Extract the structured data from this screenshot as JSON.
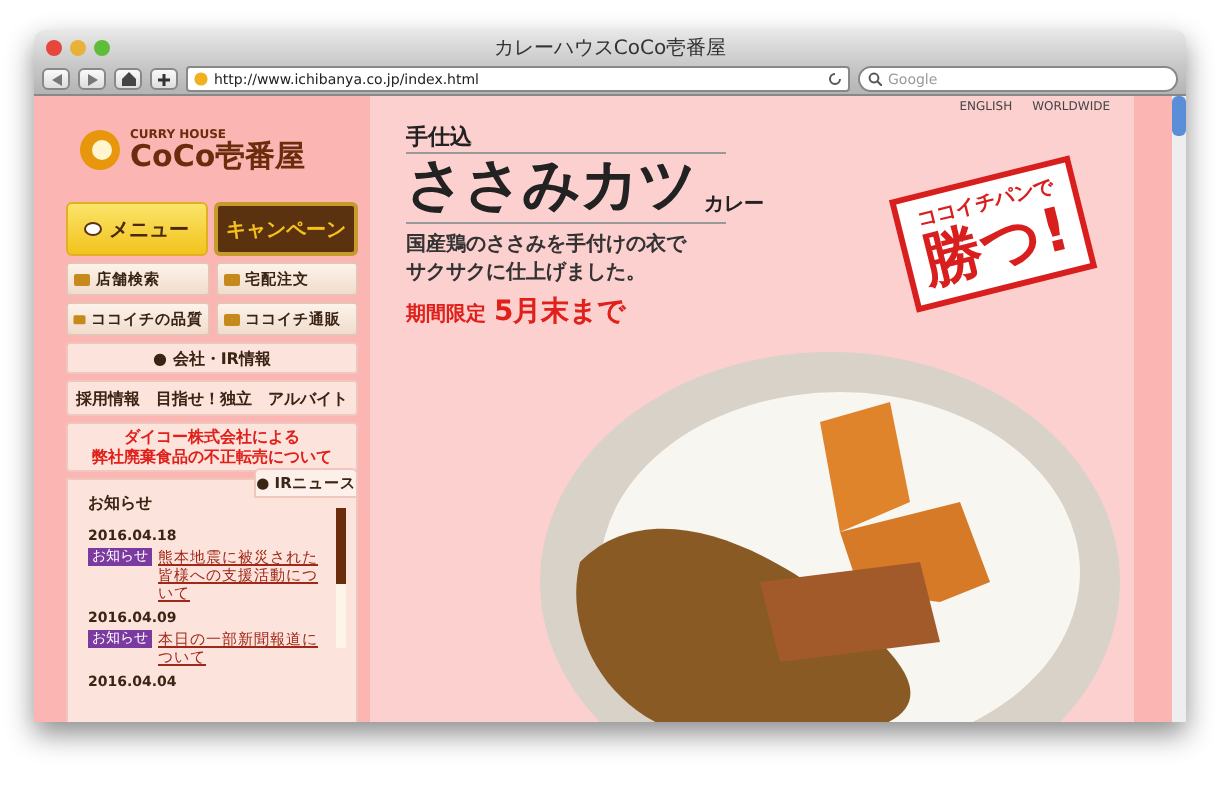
{
  "window": {
    "title": "カレーハウスCoCo壱番屋"
  },
  "toolbar": {
    "url": "http://www.ichibanya.co.jp/index.html",
    "search_placeholder": "Google"
  },
  "sidebar": {
    "logo_tagline": "CURRY HOUSE",
    "logo_name": "CoCo壱番屋",
    "main_buttons": [
      {
        "label": "メニュー",
        "kind": "light"
      },
      {
        "label": "キャンペーン",
        "kind": "framed"
      }
    ],
    "tiles": [
      "店舗検索",
      "宅配注文",
      "ココイチの品質",
      "ココイチ通販"
    ],
    "company_link": "● 会社・IR情報",
    "links": [
      "採用情報",
      "目指せ！独立",
      "アルバイト"
    ],
    "notice_lines": [
      "ダイコー株式会社による",
      "弊社廃棄食品の不正転売について"
    ],
    "news": {
      "title": "お知らせ",
      "tab": "● IRニュース",
      "items": [
        {
          "date": "2016.04.18",
          "tag": "お知らせ",
          "text": "熊本地震に被災された皆様への支援活動について"
        },
        {
          "date": "2016.04.09",
          "tag": "お知らせ",
          "text": "本日の一部新聞報道について"
        },
        {
          "date": "2016.04.04"
        }
      ]
    }
  },
  "hero": {
    "links": [
      "ENGLISH",
      "WORLDWIDE"
    ],
    "kicker": "手仕込",
    "title": "ささみカツ",
    "title_suffix": "カレー",
    "description_lines": [
      "国産鶏のささみを手付けの衣で",
      "サクサクに仕上げました。"
    ],
    "period_label": "期間限定",
    "period": "5月末まで",
    "stamp_top": "ココイチパンで",
    "stamp_main": "勝つ!"
  }
}
